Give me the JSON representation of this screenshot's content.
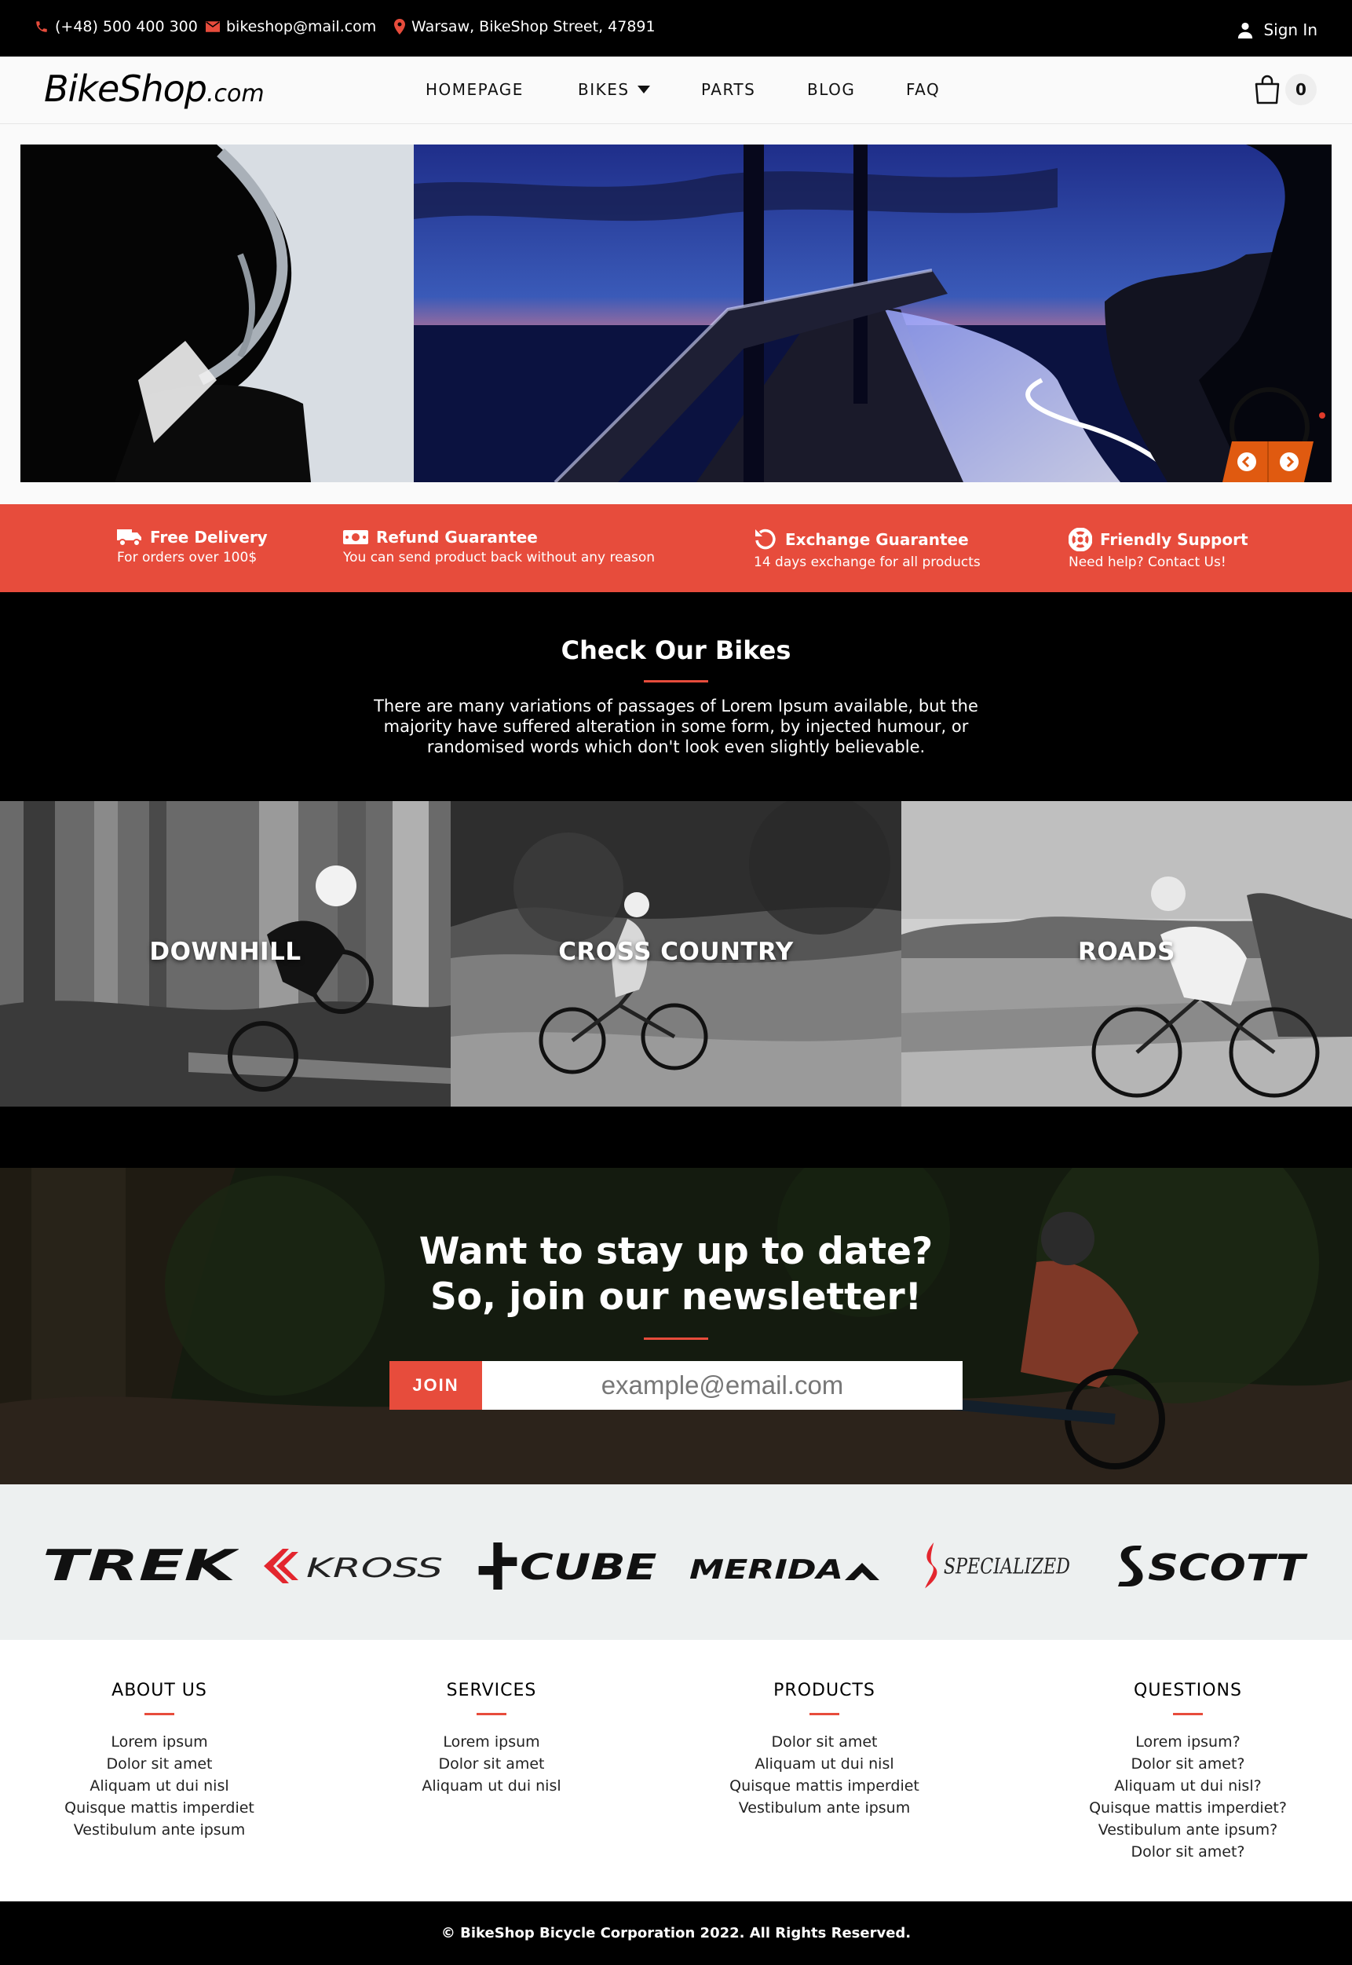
{
  "topbar": {
    "phone": "(+48) 500 400 300",
    "email": "bikeshop@mail.com",
    "address": "Warsaw, BikeShop Street, 47891",
    "signin": "Sign In"
  },
  "header": {
    "logo_main": "BikeShop",
    "logo_tld": ".com",
    "nav": [
      "HOMEPAGE",
      "BIKES",
      "PARTS",
      "BLOG",
      "FAQ"
    ],
    "cart_count": "0"
  },
  "features": [
    {
      "icon": "truck-icon",
      "title": "Free Delivery",
      "subtitle": "For orders over 100$"
    },
    {
      "icon": "money-icon",
      "title": "Refund Guarantee",
      "subtitle": "You can send product back without any reason"
    },
    {
      "icon": "rotate-icon",
      "title": "Exchange Guarantee",
      "subtitle": "14 days exchange for all products"
    },
    {
      "icon": "lifebuoy-icon",
      "title": "Friendly Support",
      "subtitle": "Need help? Contact Us!"
    }
  ],
  "bikes_section": {
    "title": "Check Our Bikes",
    "description": "There are many variations of passages of Lorem Ipsum available, but the majority have suffered alteration in some form, by injected humour, or randomised words which don't look even slightly believable.",
    "categories": [
      "DOWNHILL",
      "CROSS COUNTRY",
      "ROADS"
    ]
  },
  "newsletter": {
    "line1": "Want to stay up to date?",
    "line2": "So, join our newsletter!",
    "button": "JOIN",
    "placeholder": "example@email.com"
  },
  "brands": [
    "TREK",
    "KROSS",
    "CUBE",
    "MERIDA",
    "SPECIALIZED",
    "SCOTT"
  ],
  "footer": {
    "columns": [
      {
        "title": "ABOUT US",
        "links": [
          "Lorem ipsum",
          "Dolor sit amet",
          "Aliquam ut dui nisl",
          "Quisque mattis imperdiet",
          "Vestibulum ante ipsum"
        ]
      },
      {
        "title": "SERVICES",
        "links": [
          "Lorem ipsum",
          "Dolor sit amet",
          "Aliquam ut dui nisl"
        ]
      },
      {
        "title": "PRODUCTS",
        "links": [
          "Dolor sit amet",
          "Aliquam ut dui nisl",
          "Quisque mattis imperdiet",
          "Vestibulum ante ipsum"
        ]
      },
      {
        "title": "QUESTIONS",
        "links": [
          "Lorem ipsum?",
          "Dolor sit amet?",
          "Aliquam ut dui nisl?",
          "Quisque mattis imperdiet?",
          "Vestibulum ante ipsum?",
          "Dolor sit amet?"
        ]
      }
    ],
    "copyright": "© BikeShop Bicycle Corporation 2022. All Rights Reserved."
  },
  "colors": {
    "accent": "#e74c3c",
    "dark": "#000000",
    "brands_bg": "#edf0f0",
    "slider_arrows": "#e05a10"
  }
}
